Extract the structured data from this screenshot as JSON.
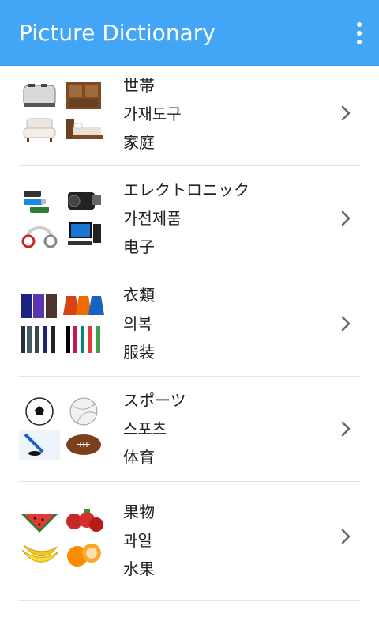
{
  "app": {
    "title": "Picture Dictionary"
  },
  "categories": [
    {
      "line1": "世帯",
      "line2": "가재도구",
      "line3": "家庭",
      "images": [
        "toaster",
        "cabinet",
        "armchair",
        "bed"
      ]
    },
    {
      "line1": "エレクトロニック",
      "line2": "가전제품",
      "line3": "电子",
      "images": [
        "usb-drives",
        "camcorder",
        "headphones",
        "desktop-computer"
      ]
    },
    {
      "line1": "衣類",
      "line2": "의복",
      "line3": "服装",
      "images": [
        "shirts",
        "skirts",
        "trousers",
        "leggings"
      ]
    },
    {
      "line1": "スポーツ",
      "line2": "스포츠",
      "line3": "体育",
      "images": [
        "soccer-ball",
        "volleyball",
        "hockey",
        "football"
      ]
    },
    {
      "line1": "果物",
      "line2": "과일",
      "line3": "水果",
      "images": [
        "watermelon",
        "strawberries",
        "bananas",
        "oranges"
      ]
    }
  ]
}
